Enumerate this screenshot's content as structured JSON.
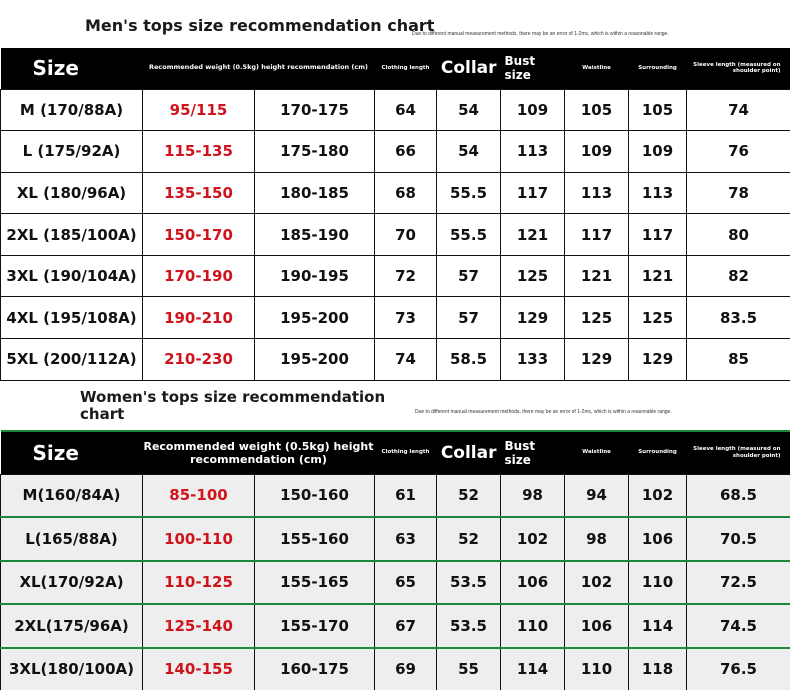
{
  "men": {
    "title": "Men's tops size recommendation chart",
    "note": "Due to different manual measurement methods, there may be an error of 1-2mc, which is within a reasonable range.",
    "headers": {
      "size": "Size",
      "recommendation": "Recommended weight (0.5kg) height recommendation (cm)",
      "clothing_length": "Clothing length",
      "collar": "Collar",
      "bust": "Bust size",
      "waistline": "Waistline",
      "surrounding": "Surrounding",
      "sleeve": "Sleeve length (measured on shoulder point)"
    },
    "rows": [
      {
        "size": "M (170/88A)",
        "weight": "95/115",
        "height": "170-175",
        "length": "64",
        "collar": "54",
        "bust": "109",
        "waist": "105",
        "surround": "105",
        "sleeve": "74"
      },
      {
        "size": "L  (175/92A)",
        "weight": "115-135",
        "height": "175-180",
        "length": "66",
        "collar": "54",
        "bust": "113",
        "waist": "109",
        "surround": "109",
        "sleeve": "76"
      },
      {
        "size": "XL  (180/96A)",
        "weight": "135-150",
        "height": "180-185",
        "length": "68",
        "collar": "55.5",
        "bust": "117",
        "waist": "113",
        "surround": "113",
        "sleeve": "78"
      },
      {
        "size": "2XL (185/100A)",
        "weight": "150-170",
        "height": "185-190",
        "length": "70",
        "collar": "55.5",
        "bust": "121",
        "waist": "117",
        "surround": "117",
        "sleeve": "80"
      },
      {
        "size": "3XL (190/104A)",
        "weight": "170-190",
        "height": "190-195",
        "length": "72",
        "collar": "57",
        "bust": "125",
        "waist": "121",
        "surround": "121",
        "sleeve": "82"
      },
      {
        "size": "4XL (195/108A)",
        "weight": "190-210",
        "height": "195-200",
        "length": "73",
        "collar": "57",
        "bust": "129",
        "waist": "125",
        "surround": "125",
        "sleeve": "83.5"
      },
      {
        "size": "5XL (200/112A)",
        "weight": "210-230",
        "height": "195-200",
        "length": "74",
        "collar": "58.5",
        "bust": "133",
        "waist": "129",
        "surround": "129",
        "sleeve": "85"
      }
    ]
  },
  "women": {
    "title_line1": "Women's tops size recommendation",
    "title_line2": "chart",
    "note": "Due to different manual measurement methods, there may be an error of 1-2mc, which is within a reasonable range.",
    "headers": {
      "size": "Size",
      "recommendation": "Recommended weight (0.5kg) height recommendation (cm)",
      "clothing_length": "Clothing length",
      "collar": "Collar",
      "bust": "Bust size",
      "waistline": "Waistline",
      "surrounding": "Surrounding",
      "sleeve": "Sleeve length (measured on shoulder point)"
    },
    "rows": [
      {
        "size": "M(160/84A)",
        "weight": "85-100",
        "height": "150-160",
        "length": "61",
        "collar": "52",
        "bust": "98",
        "waist": "94",
        "surround": "102",
        "sleeve": "68.5"
      },
      {
        "size": "L(165/88A)",
        "weight": "100-110",
        "height": "155-160",
        "length": "63",
        "collar": "52",
        "bust": "102",
        "waist": "98",
        "surround": "106",
        "sleeve": "70.5"
      },
      {
        "size": "XL(170/92A)",
        "weight": "110-125",
        "height": "155-165",
        "length": "65",
        "collar": "53.5",
        "bust": "106",
        "waist": "102",
        "surround": "110",
        "sleeve": "72.5"
      },
      {
        "size": "2XL(175/96A)",
        "weight": "125-140",
        "height": "155-170",
        "length": "67",
        "collar": "53.5",
        "bust": "110",
        "waist": "106",
        "surround": "114",
        "sleeve": "74.5"
      },
      {
        "size": "3XL(180/100A)",
        "weight": "140-155",
        "height": "160-175",
        "length": "69",
        "collar": "55",
        "bust": "114",
        "waist": "110",
        "surround": "118",
        "sleeve": "76.5"
      }
    ]
  },
  "colors": {
    "weight_text": "#d0141d",
    "header_bg": "#000000",
    "accent_green": "#1a8a3a",
    "women_row_bg": "#eeeeee"
  }
}
